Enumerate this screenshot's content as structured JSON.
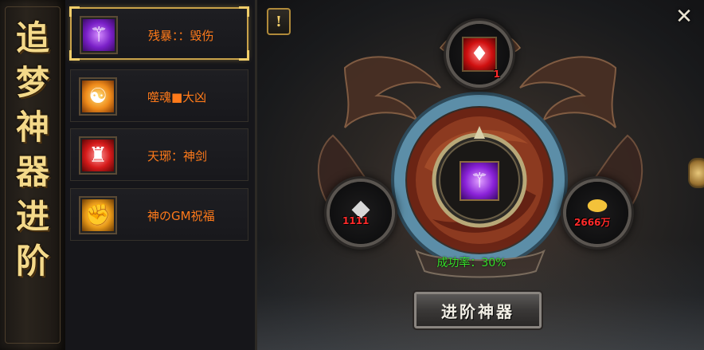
{
  "panel": {
    "title_chars": [
      "追",
      "梦",
      "神",
      "器",
      "进",
      "阶"
    ]
  },
  "items": [
    {
      "label": "残暴：：毁伤",
      "icon": "purple-trident-icon",
      "selected": true
    },
    {
      "label": "噬魂■大凶",
      "icon": "orange-soul-icon",
      "selected": false
    },
    {
      "label": "天琊：神剑",
      "icon": "red-warrior-icon",
      "selected": false
    },
    {
      "label": "神のGM祝福",
      "icon": "golden-fist-icon",
      "selected": false
    }
  ],
  "slots": {
    "top": {
      "icon": "red-blood-drop-icon",
      "count": "1"
    },
    "left": {
      "icon": "silver-ore-icon",
      "count": "1111"
    },
    "center": {
      "icon": "purple-trident-icon"
    },
    "right": {
      "icon": "gold-ingot-icon",
      "count": "2666万"
    }
  },
  "success_rate": "成功率：30%",
  "upgrade_button": "进阶神器",
  "buttons": {
    "help": "!",
    "close": "✕"
  },
  "colors": {
    "item_label": "#ff7a1a",
    "success_rate": "#35e02a",
    "count": "#ff2a2a",
    "title_gold": "#f4d98a"
  }
}
